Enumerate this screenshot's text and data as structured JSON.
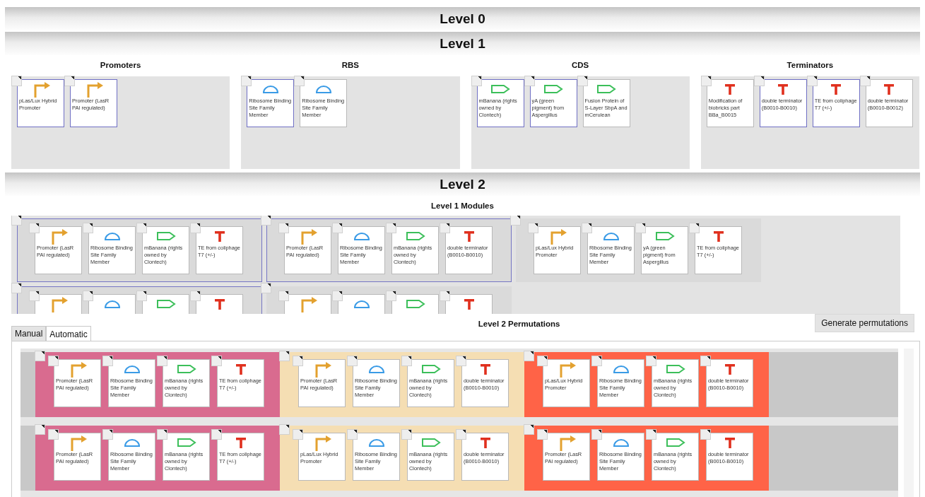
{
  "level0": {
    "title": "Level 0"
  },
  "level1": {
    "title": "Level 1",
    "groups": [
      {
        "title": "Promoters",
        "parts": [
          {
            "kind": "promoter",
            "label": "pLas/Lux Hybrid Promoter",
            "selected": true
          },
          {
            "kind": "promoter",
            "label": "Promoter (LasR PAI regulated)",
            "selected": true
          }
        ]
      },
      {
        "title": "RBS",
        "parts": [
          {
            "kind": "rbs",
            "label": "Ribosome Binding Site Family Member",
            "selected": true
          },
          {
            "kind": "rbs",
            "label": "Ribosome Binding Site Family Member",
            "selected": false
          }
        ]
      },
      {
        "title": "CDS",
        "parts": [
          {
            "kind": "cds",
            "label": "mBanana (rights owned by Clontech)",
            "selected": true
          },
          {
            "kind": "cds",
            "label": "yA (green pigment) from Aspergillus",
            "selected": true
          },
          {
            "kind": "cds",
            "label": "Fusion Protein of S-Layer SbpA and mCerulean",
            "selected": false
          }
        ]
      },
      {
        "title": "Terminators",
        "parts": [
          {
            "kind": "terminator",
            "label": "Modification of biobricks part BBa_B0015",
            "selected": false
          },
          {
            "kind": "terminator",
            "label": "double terminator (B0010-B0010)",
            "selected": true
          },
          {
            "kind": "terminator",
            "label": "TE from coliphage T7 (+/-)",
            "selected": true
          },
          {
            "kind": "terminator",
            "label": "double terminator (B0010-B0012)",
            "selected": false
          }
        ]
      }
    ]
  },
  "level2": {
    "title": "Level 2",
    "modules": {
      "title": "Level 1 Modules",
      "items": [
        {
          "selected": true,
          "parts": [
            {
              "kind": "promoter",
              "label": "Promoter (LasR PAI regulated)"
            },
            {
              "kind": "rbs",
              "label": "Ribosome Binding Site Family Member"
            },
            {
              "kind": "cds",
              "label": "mBanana (rights owned by Clontech)"
            },
            {
              "kind": "terminator",
              "label": "TE from coliphage T7 (+/-)"
            }
          ]
        },
        {
          "selected": true,
          "parts": [
            {
              "kind": "promoter",
              "label": "Promoter (LasR PAI regulated)"
            },
            {
              "kind": "rbs",
              "label": "Ribosome Binding Site Family Member"
            },
            {
              "kind": "cds",
              "label": "mBanana (rights owned by Clontech)"
            },
            {
              "kind": "terminator",
              "label": "double terminator (B0010-B0010)"
            }
          ]
        },
        {
          "selected": false,
          "parts": [
            {
              "kind": "promoter",
              "label": "pLas/Lux Hybrid Promoter"
            },
            {
              "kind": "rbs",
              "label": "Ribosome Binding Site Family Member"
            },
            {
              "kind": "cds",
              "label": "yA (green pigment) from Aspergillus"
            },
            {
              "kind": "terminator",
              "label": "TE from coliphage T7 (+/-)"
            }
          ]
        },
        {
          "selected": true,
          "parts": [
            {
              "kind": "promoter"
            },
            {
              "kind": "rbs"
            },
            {
              "kind": "cds"
            },
            {
              "kind": "terminator"
            }
          ]
        },
        {
          "selected": false,
          "parts": [
            {
              "kind": "promoter"
            },
            {
              "kind": "rbs"
            },
            {
              "kind": "cds"
            },
            {
              "kind": "terminator"
            }
          ]
        }
      ]
    },
    "permutations": {
      "title": "Level 2 Permutations",
      "button": "Generate permutations",
      "tabs": [
        {
          "label": "Manual",
          "selected": false
        },
        {
          "label": "Automatic",
          "selected": true
        }
      ],
      "rows": [
        {
          "blocks": [
            {
              "color": "#d96b8f",
              "parts": [
                {
                  "kind": "promoter",
                  "label": "Promoter (LasR PAI regulated)"
                },
                {
                  "kind": "rbs",
                  "label": "Ribosome Binding Site Family Member"
                },
                {
                  "kind": "cds",
                  "label": "mBanana (rights owned by Clontech)"
                },
                {
                  "kind": "terminator",
                  "label": "TE from coliphage T7 (+/-)"
                }
              ]
            },
            {
              "color": "#f5deb3",
              "parts": [
                {
                  "kind": "promoter",
                  "label": "Promoter (LasR PAI regulated)"
                },
                {
                  "kind": "rbs",
                  "label": "Ribosome Binding Site Family Member"
                },
                {
                  "kind": "cds",
                  "label": "mBanana (rights owned by Clontech)"
                },
                {
                  "kind": "terminator",
                  "label": "double terminator (B0010-B0010)"
                }
              ]
            },
            {
              "color": "#ff6347",
              "parts": [
                {
                  "kind": "promoter",
                  "label": "pLas/Lux Hybrid Promoter"
                },
                {
                  "kind": "rbs",
                  "label": "Ribosome Binding Site Family Member"
                },
                {
                  "kind": "cds",
                  "label": "mBanana (rights owned by Clontech)"
                },
                {
                  "kind": "terminator",
                  "label": "double terminator (B0010-B0010)"
                }
              ]
            }
          ]
        },
        {
          "blocks": [
            {
              "color": "#d96b8f",
              "parts": [
                {
                  "kind": "promoter",
                  "label": "Promoter (LasR PAI regulated)"
                },
                {
                  "kind": "rbs",
                  "label": "Ribosome Binding Site Family Member"
                },
                {
                  "kind": "cds",
                  "label": "mBanana (rights owned by Clontech)"
                },
                {
                  "kind": "terminator",
                  "label": "TE from coliphage T7 (+/-)"
                }
              ]
            },
            {
              "color": "#f5deb3",
              "parts": [
                {
                  "kind": "promoter",
                  "label": "pLas/Lux Hybrid Promoter"
                },
                {
                  "kind": "rbs",
                  "label": "Ribosome Binding Site Family Member"
                },
                {
                  "kind": "cds",
                  "label": "mBanana (rights owned by Clontech)"
                },
                {
                  "kind": "terminator",
                  "label": "double terminator (B0010-B0010)"
                }
              ]
            },
            {
              "color": "#ff6347",
              "parts": [
                {
                  "kind": "promoter",
                  "label": "Promoter (LasR PAI regulated)"
                },
                {
                  "kind": "rbs",
                  "label": "Ribosome Binding Site Family Member"
                },
                {
                  "kind": "cds",
                  "label": "mBanana (rights owned by Clontech)"
                },
                {
                  "kind": "terminator",
                  "label": "double terminator (B0010-B0010)"
                }
              ]
            }
          ]
        }
      ]
    }
  }
}
